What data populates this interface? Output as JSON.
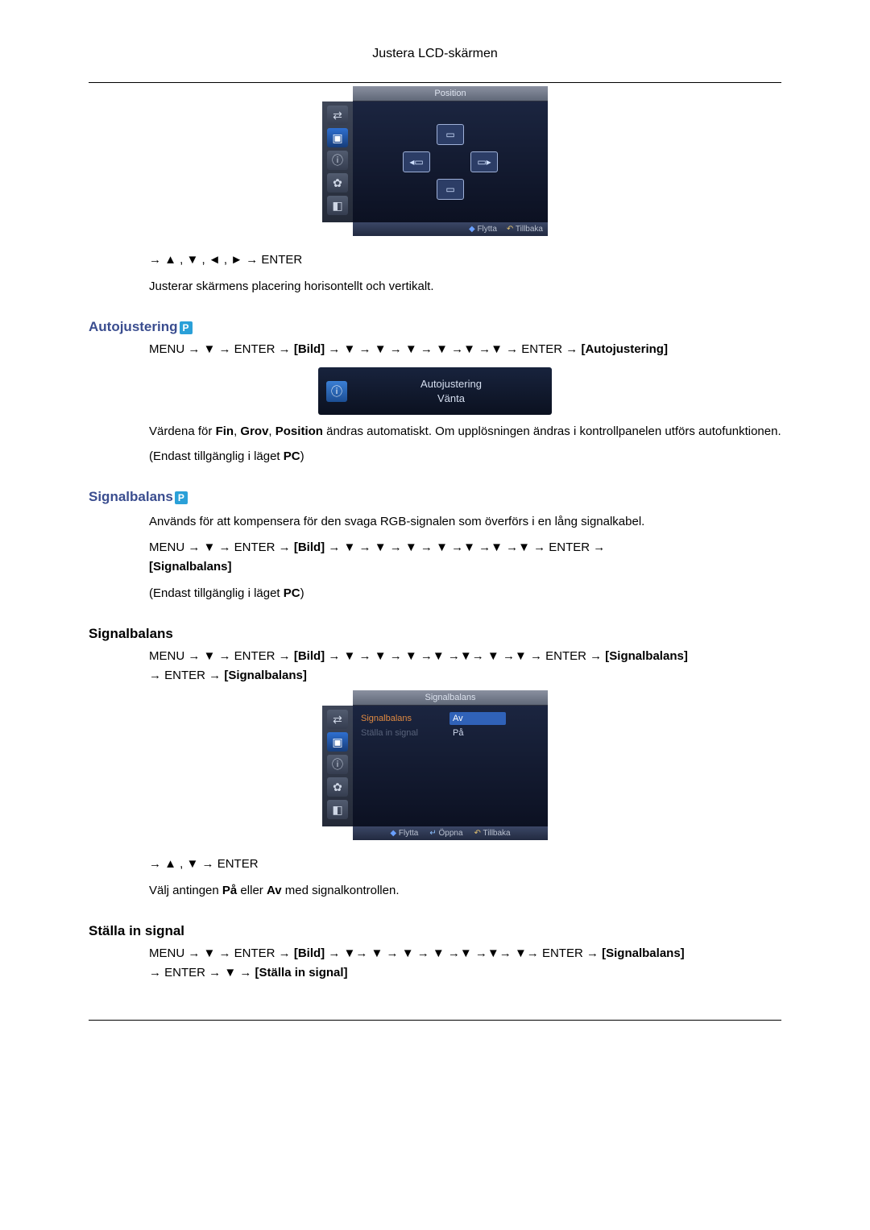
{
  "header": {
    "title": "Justera LCD-skärmen"
  },
  "osd_position": {
    "title": "Position",
    "foot_move": "Flytta",
    "foot_back": "Tillbaka"
  },
  "nav_arrows_line": "→ ▲ , ▼ , ◄ , ► → ENTER",
  "position_desc": "Justerar skärmens placering horisontellt och vertikalt.",
  "headings": {
    "autojustering": "Autojustering",
    "signalbalans_p": "Signalbalans",
    "signalbalans": "Signalbalans",
    "stallain": "Ställa in signal"
  },
  "p_badge": "P",
  "autojustering": {
    "nav_prefix": "MENU → ▼ → ENTER → ",
    "nav_bild": "[Bild]",
    "nav_mid": " → ▼ → ▼ → ▼ → ▼ →▼ →▼ → ENTER → ",
    "nav_last": "[Autojustering]",
    "banner_line1": "Autojustering",
    "banner_line2": "Vänta",
    "desc_1_a": "Värdena för ",
    "desc_1_b": "Fin",
    "desc_1_c": ", ",
    "desc_1_d": "Grov",
    "desc_1_e": ", ",
    "desc_1_f": "Position",
    "desc_1_g": " ändras automatiskt. Om upplösningen ändras i kontrollpanelen utförs autofunktionen.",
    "desc_2_a": "(Endast tillgänglig i läget ",
    "desc_2_b": "PC",
    "desc_2_c": ")"
  },
  "signalbalans_p": {
    "desc": "Används för att kompensera för den svaga RGB-signalen som överförs i en lång signalkabel.",
    "nav_prefix": "MENU → ▼ → ENTER → ",
    "nav_bild": "[Bild]",
    "nav_mid": " → ▼ → ▼ → ▼ → ▼ →▼ →▼ →▼ → ENTER → ",
    "nav_last": "[Signalbalans]",
    "only_a": "(Endast tillgänglig i läget ",
    "only_b": "PC",
    "only_c": ")"
  },
  "signalbalans": {
    "nav_line_a": "MENU → ▼ → ENTER → ",
    "nav_bild": "[Bild]",
    "nav_line_b": " → ▼ → ▼ → ▼ →▼ →▼→ ▼ →▼ → ENTER → ",
    "nav_line_c": "[Signalbalans]",
    "nav_line_d": " → ENTER → ",
    "nav_line_e": "[Signalbalans]",
    "osd_title": "Signalbalans",
    "menu_item_active": "Signalbalans",
    "menu_item_dim": "Ställa in signal",
    "opt_off": "Av",
    "opt_on": "På",
    "foot_move": "Flytta",
    "foot_open": "Öppna",
    "foot_back": "Tillbaka",
    "arrows_line": "→ ▲ , ▼ → ENTER",
    "desc_a": "Välj antingen ",
    "desc_b": "På",
    "desc_c": " eller ",
    "desc_d": "Av",
    "desc_e": " med signalkontrollen."
  },
  "stallain": {
    "nav_a": "MENU → ▼ → ENTER → ",
    "nav_bild": "[Bild]",
    "nav_b": " → ▼→ ▼ → ▼ → ▼ →▼ →▼→ ▼→ ENTER → ",
    "nav_c": "[Signalbalans]",
    "nav_d": " → ENTER → ▼ → ",
    "nav_e": "[Ställa in signal]"
  }
}
